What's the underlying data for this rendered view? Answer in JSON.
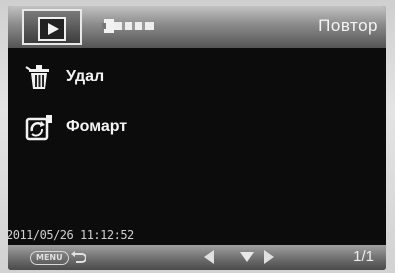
{
  "topbar": {
    "tabs": [
      {
        "icon": "play-icon",
        "selected": true
      },
      {
        "icon": "wrench-icon",
        "selected": false
      }
    ],
    "title": "Повтор"
  },
  "menu": {
    "items": [
      {
        "icon": "trash-icon",
        "label": "Удал"
      },
      {
        "icon": "format-icon",
        "label": "Фомарт"
      }
    ]
  },
  "status": {
    "timestamp": "2011/05/26  11:12:52"
  },
  "bottombar": {
    "menu_label": "MENU",
    "counter": "1/1"
  },
  "colors": {
    "screen_bg": "#0c0c0c",
    "text": "#f4f4f4",
    "bar_gray": "#8a8a8a"
  }
}
